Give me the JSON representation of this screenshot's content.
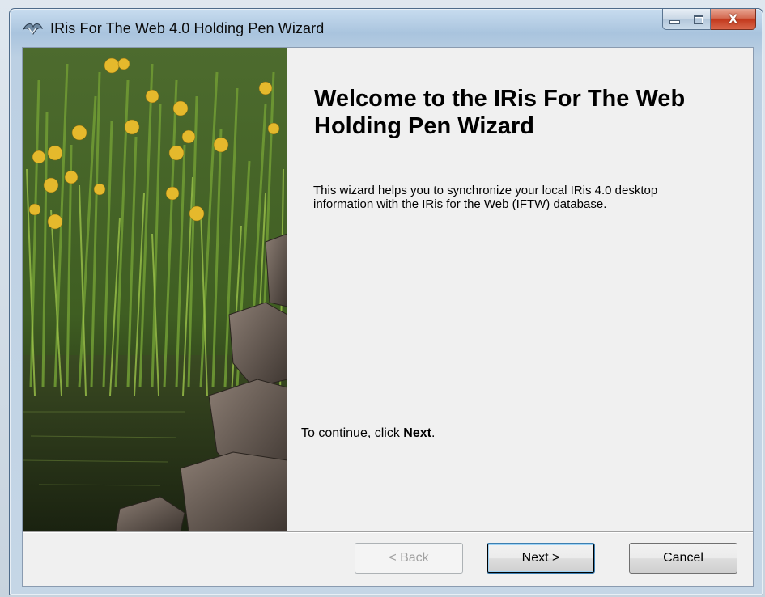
{
  "window": {
    "title": "IRis For The Web 4.0 Holding Pen Wizard",
    "controls": {
      "minimize": "minimize-icon",
      "maximize": "maximize-icon",
      "close": "close-icon",
      "close_glyph": "X"
    }
  },
  "content": {
    "heading": "Welcome to the IRis For The Web Holding Pen Wizard",
    "description": "This wizard helps you to synchronize your local IRis 4.0 desktop information with the IRis for the Web (IFTW) database.",
    "continue_prefix": "To continue, click ",
    "continue_bold": "Next",
    "continue_suffix": "."
  },
  "buttons": {
    "back": "< Back",
    "next": "Next >",
    "cancel": "Cancel"
  },
  "colors": {
    "accent": "#3c7fb1",
    "close_red": "#c2391d",
    "panel": "#f0f0f0"
  }
}
